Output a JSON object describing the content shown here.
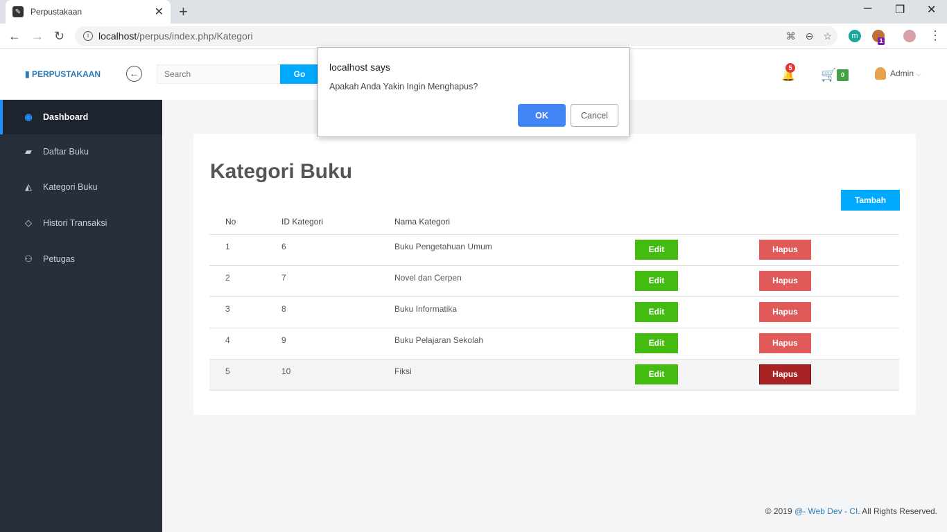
{
  "browser": {
    "tab_title": "Perpustakaan",
    "url_host": "localhost",
    "url_path": "/perpus/index.php/Kategori",
    "ext_m": "m",
    "ext_badge": "1"
  },
  "header": {
    "brand": "PERPUSTAKAAN",
    "search_placeholder": "Search",
    "go_label": "Go",
    "notif_count": "5",
    "cart_count": "0",
    "user_name": "Admin"
  },
  "sidebar": {
    "items": [
      {
        "label": "Dashboard",
        "icon": "palette-icon"
      },
      {
        "label": "Daftar Buku",
        "icon": "book-icon"
      },
      {
        "label": "Kategori Buku",
        "icon": "area-chart-icon"
      },
      {
        "label": "Histori Transaksi",
        "icon": "inbox-icon"
      },
      {
        "label": "Petugas",
        "icon": "users-icon"
      }
    ]
  },
  "main": {
    "title": "Kategori Buku",
    "add_label": "Tambah",
    "columns": [
      "No",
      "ID Kategori",
      "Nama Kategori"
    ],
    "edit_label": "Edit",
    "delete_label": "Hapus",
    "rows": [
      {
        "no": "1",
        "id": "6",
        "name": "Buku Pengetahuan Umum"
      },
      {
        "no": "2",
        "id": "7",
        "name": "Novel dan Cerpen"
      },
      {
        "no": "3",
        "id": "8",
        "name": "Buku Informatika"
      },
      {
        "no": "4",
        "id": "9",
        "name": "Buku Pelajaran Sekolah"
      },
      {
        "no": "5",
        "id": "10",
        "name": "Fiksi"
      }
    ]
  },
  "footer": {
    "prefix": "© 2019 ",
    "link": "@- Web Dev - CI",
    "suffix": ". All Rights Reserved."
  },
  "dialog": {
    "title": "localhost says",
    "message": "Apakah Anda Yakin Ingin Menghapus?",
    "ok_label": "OK",
    "cancel_label": "Cancel"
  },
  "colors": {
    "accent": "#00aaff",
    "sidebar_bg": "#282f3a",
    "edit_green": "#44bb11",
    "delete_red": "#e05a5a",
    "dialog_ok": "#4285f4"
  }
}
